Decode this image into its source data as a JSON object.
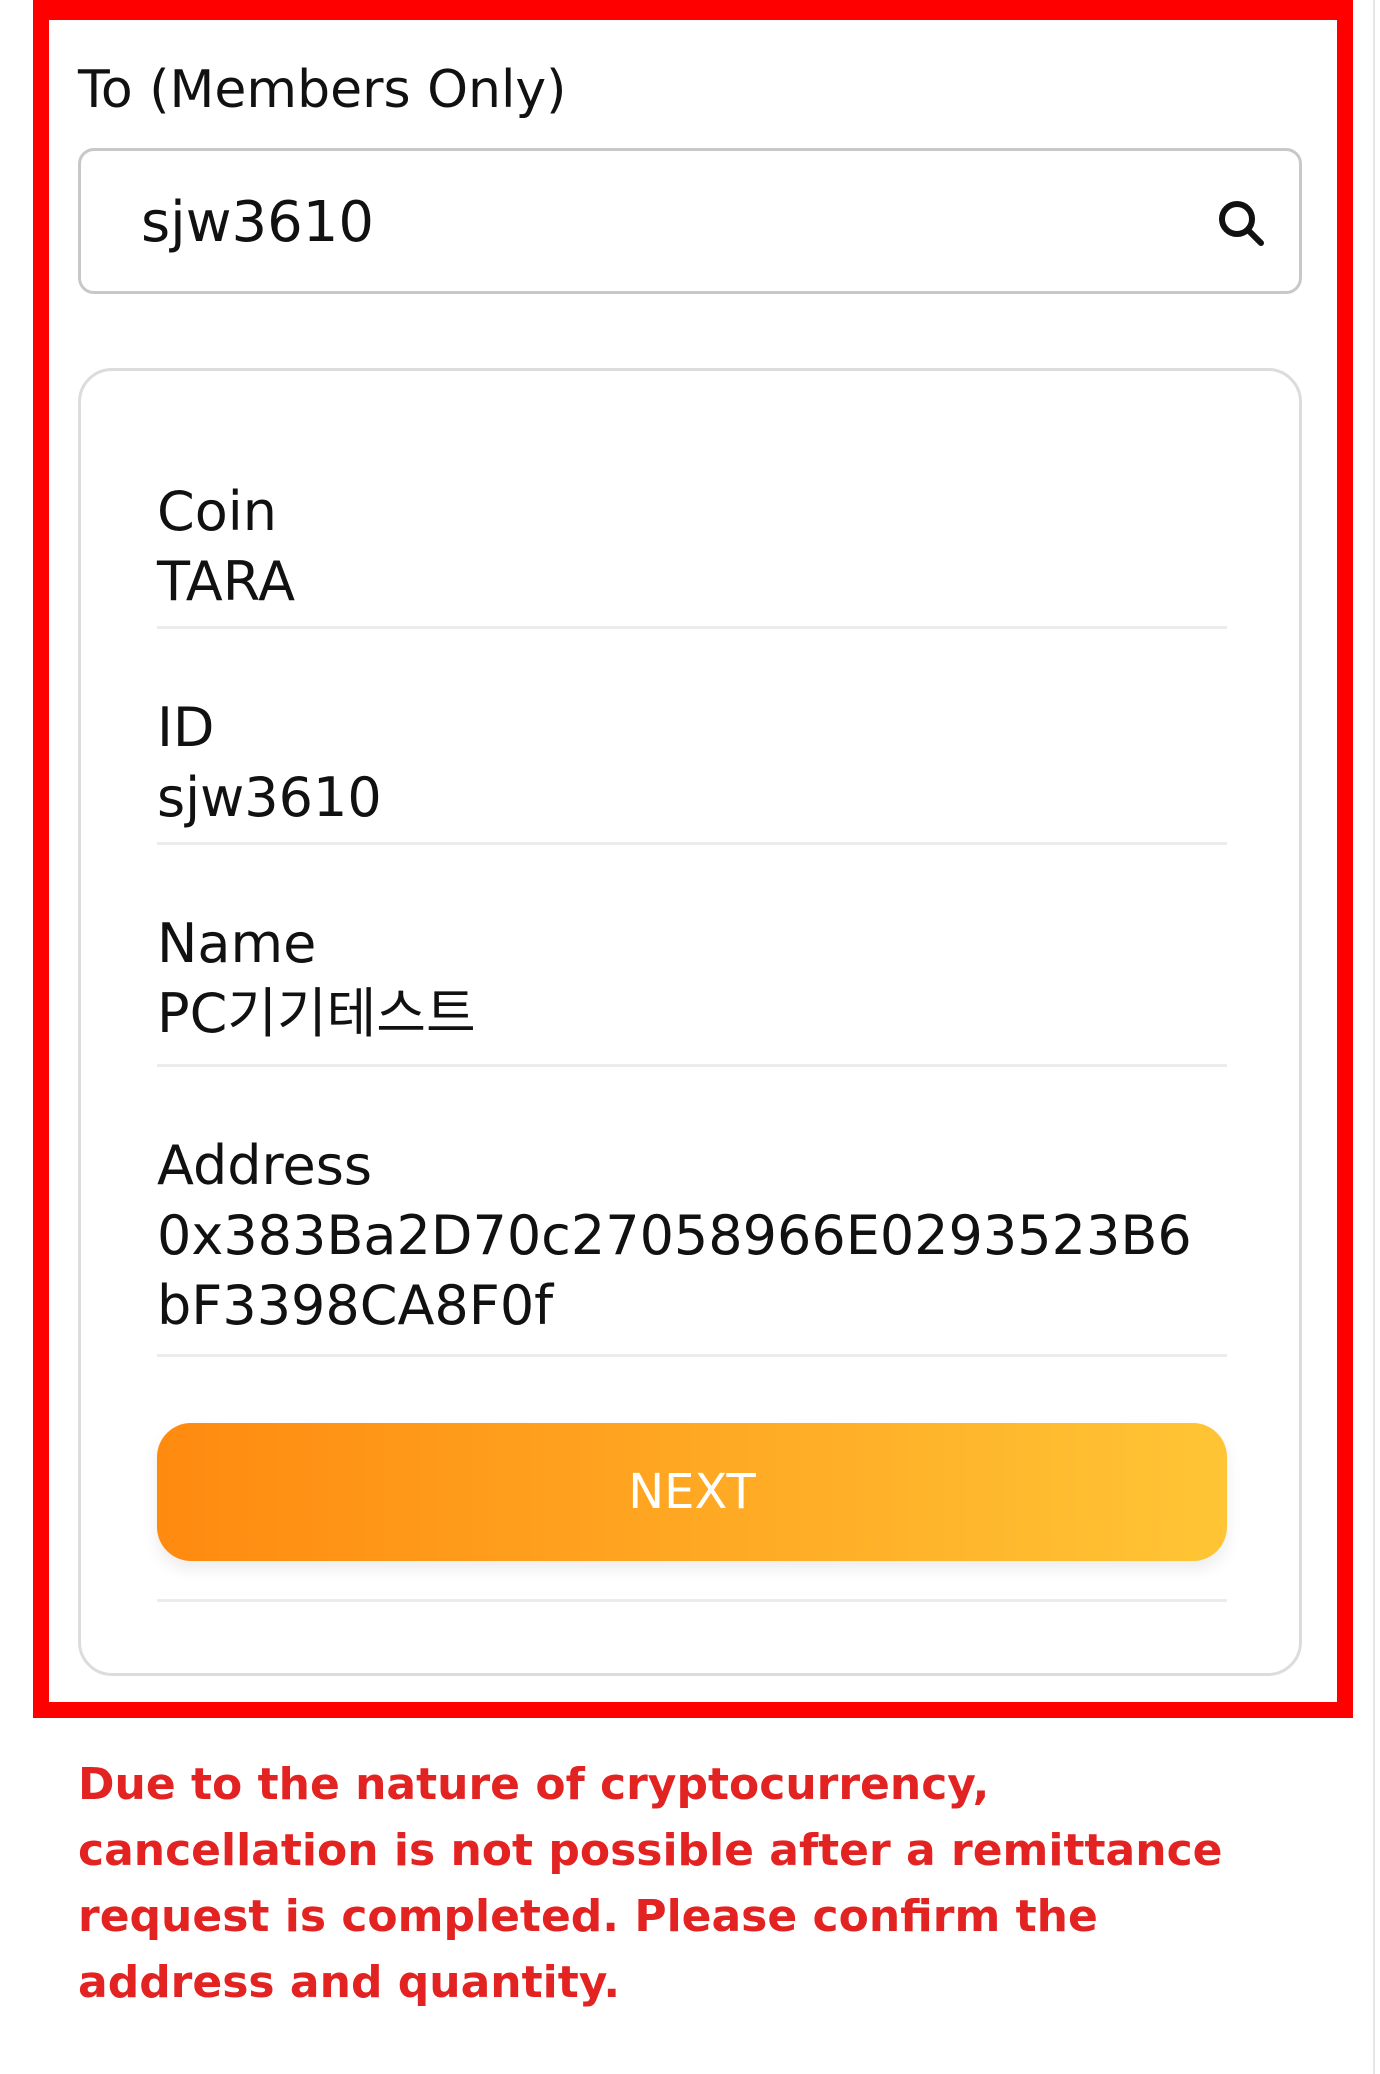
{
  "recipient": {
    "label": "To (Members Only)",
    "search_value": "sjw3610",
    "search_icon": "search-icon"
  },
  "details": {
    "coin_label": "Coin",
    "coin_value": "TARA",
    "id_label": "ID",
    "id_value": "sjw3610",
    "name_label": "Name",
    "name_value": "PC기기테스트",
    "address_label": "Address",
    "address_value": "0x383Ba2D70c27058966E0293523B6bF3398CA8F0f"
  },
  "actions": {
    "next_label": "NEXT"
  },
  "notice": {
    "warning": "Due to the nature of cryptocurrency, cancellation is not possible after a remittance request is completed. Please confirm the address and quantity."
  },
  "colors": {
    "highlight_border": "#ff0000",
    "warning_text": "#e32222",
    "button_gradient_start": "#ff8a10",
    "button_gradient_end": "#ffc535"
  }
}
